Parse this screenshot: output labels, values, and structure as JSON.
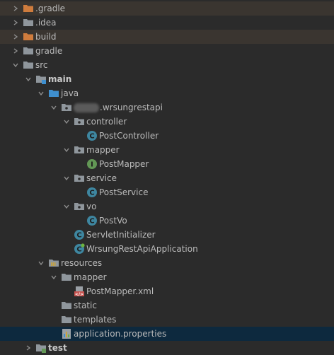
{
  "colors": {
    "background": "#2b2b2b",
    "text": "#bbbbbb",
    "excluded_row": "#3a3530",
    "selected_row": "#0d293e",
    "folder_plain": "#8f969c",
    "folder_excluded": "#cf7c3d",
    "folder_source": "#3f8fce",
    "class_icon": "#3e86a0",
    "interface_icon": "#629755"
  },
  "tree": [
    {
      "label": ".gradle",
      "expanded": false,
      "icon": "folder-excluded-icon"
    },
    {
      "label": ".idea",
      "expanded": false,
      "icon": "folder-icon"
    },
    {
      "label": "build",
      "expanded": false,
      "icon": "folder-excluded-icon"
    },
    {
      "label": "gradle",
      "expanded": false,
      "icon": "folder-icon"
    },
    {
      "label": "src",
      "expanded": true,
      "icon": "folder-icon"
    },
    {
      "label": "main",
      "expanded": true,
      "icon": "module-folder-icon"
    },
    {
      "label": "java",
      "expanded": true,
      "icon": "source-folder-icon"
    },
    {
      "label": ".wrsungrestapi",
      "expanded": true,
      "icon": "package-icon"
    },
    {
      "label": "controller",
      "expanded": true,
      "icon": "package-icon"
    },
    {
      "label": "PostController",
      "icon": "class-icon"
    },
    {
      "label": "mapper",
      "expanded": true,
      "icon": "package-icon"
    },
    {
      "label": "PostMapper",
      "icon": "interface-icon"
    },
    {
      "label": "service",
      "expanded": true,
      "icon": "package-icon"
    },
    {
      "label": "PostService",
      "icon": "class-icon"
    },
    {
      "label": "vo",
      "expanded": true,
      "icon": "package-icon"
    },
    {
      "label": "PostVo",
      "icon": "class-icon"
    },
    {
      "label": "ServletInitializer",
      "icon": "class-icon"
    },
    {
      "label": "WrsungRestApiApplication",
      "icon": "spring-boot-class-icon"
    },
    {
      "label": "resources",
      "expanded": true,
      "icon": "resources-folder-icon"
    },
    {
      "label": "mapper",
      "expanded": true,
      "icon": "folder-icon"
    },
    {
      "label": "PostMapper.xml",
      "icon": "xml-file-icon"
    },
    {
      "label": "static",
      "icon": "folder-icon"
    },
    {
      "label": "templates",
      "icon": "folder-icon"
    },
    {
      "label": "application.properties",
      "icon": "properties-file-icon",
      "selected": true
    },
    {
      "label": "test",
      "expanded": false,
      "icon": "module-folder-icon"
    }
  ]
}
